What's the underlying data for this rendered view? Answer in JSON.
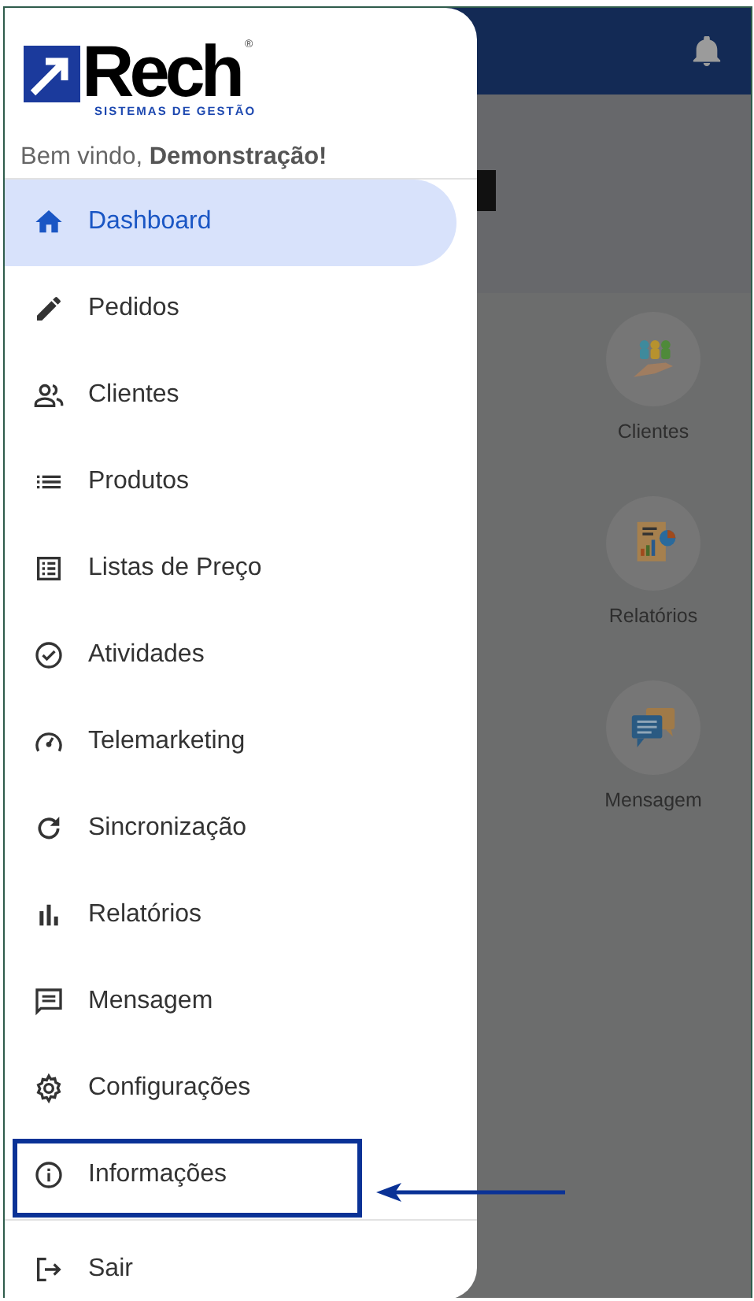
{
  "dashboard_tiles": [
    {
      "label": "Clientes"
    },
    {
      "label": "Relatórios"
    },
    {
      "label": "Mensagem"
    }
  ],
  "drawer": {
    "logo": {
      "name": "Rech",
      "mark": "®",
      "tagline": "SISTEMAS DE GESTÃO"
    },
    "welcome": "Bem vindo, **Demonstração!**",
    "menu": [
      {
        "label": "Dashboard",
        "selected": true,
        "highlighted": false
      },
      {
        "label": "Pedidos",
        "selected": false,
        "highlighted": false
      },
      {
        "label": "Clientes",
        "selected": false,
        "highlighted": false
      },
      {
        "label": "Produtos",
        "selected": false,
        "highlighted": false
      },
      {
        "label": "Listas de Preço",
        "selected": false,
        "highlighted": false
      },
      {
        "label": "Atividades",
        "selected": false,
        "highlighted": false
      },
      {
        "label": "Telemarketing",
        "selected": false,
        "highlighted": false
      },
      {
        "label": "Sincronização",
        "selected": false,
        "highlighted": false
      },
      {
        "label": "Relatórios",
        "selected": false,
        "highlighted": false
      },
      {
        "label": "Mensagem",
        "selected": false,
        "highlighted": false
      },
      {
        "label": "Configurações",
        "selected": false,
        "highlighted": false
      },
      {
        "label": "Informações",
        "selected": false,
        "highlighted": true
      }
    ],
    "footer_item": {
      "label": "Sair"
    }
  }
}
